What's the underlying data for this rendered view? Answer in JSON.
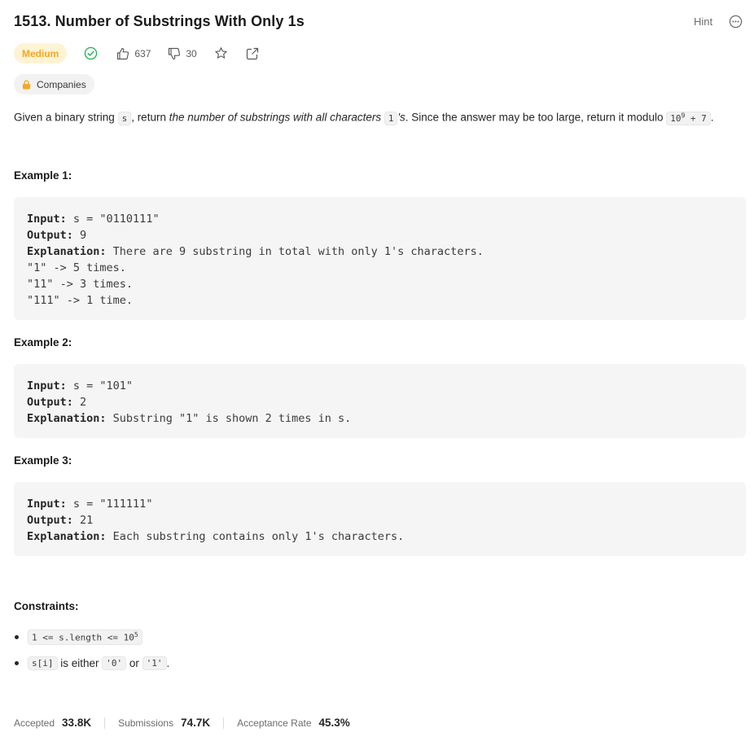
{
  "problem": {
    "title": "1513. Number of Substrings With Only 1s",
    "hint_label": "Hint",
    "difficulty": "Medium",
    "likes": "637",
    "dislikes": "30",
    "companies_label": "Companies"
  },
  "description": {
    "p1": "Given a binary string ",
    "code_s": "s",
    "p2": ", return ",
    "italic": "the number of substrings with all characters ",
    "code_1": "1",
    "p3": "'s",
    "p4": ". Since the answer may be too large, return it modulo ",
    "mod_base": "10",
    "mod_exp": "9",
    "mod_tail": " + 7",
    "p5": "."
  },
  "examples": [
    {
      "title": "Example 1:",
      "input_label": "Input:",
      "input_value": " s = \"0110111\"",
      "output_label": "Output:",
      "output_value": " 9",
      "explanation_label": "Explanation:",
      "explanation_value": " There are 9 substring in total with only 1's characters.",
      "extra": [
        "\"1\" -> 5 times.",
        "\"11\" -> 3 times.",
        "\"111\" -> 1 time."
      ]
    },
    {
      "title": "Example 2:",
      "input_label": "Input:",
      "input_value": " s = \"101\"",
      "output_label": "Output:",
      "output_value": " 2",
      "explanation_label": "Explanation:",
      "explanation_value": " Substring \"1\" is shown 2 times in s.",
      "extra": []
    },
    {
      "title": "Example 3:",
      "input_label": "Input:",
      "input_value": " s = \"111111\"",
      "output_label": "Output:",
      "output_value": " 21",
      "explanation_label": "Explanation:",
      "explanation_value": " Each substring contains only 1's characters.",
      "extra": []
    }
  ],
  "constraints": {
    "title": "Constraints:",
    "c1_code": "1 <= s.length <= 10",
    "c1_exp": "5",
    "c2_code": "s[i]",
    "c2_text1": " is either ",
    "c2_zero": "'0'",
    "c2_text2": " or ",
    "c2_one": "'1'",
    "c2_end": "."
  },
  "stats": {
    "accepted_label": "Accepted",
    "accepted_value": "33.8K",
    "submissions_label": "Submissions",
    "submissions_value": "74.7K",
    "rate_label": "Acceptance Rate",
    "rate_value": "45.3%"
  },
  "icons": {
    "solved": "check-circle-icon",
    "like": "thumbs-up-icon",
    "dislike": "thumbs-down-icon",
    "favorite": "star-icon",
    "share": "share-icon",
    "lock": "lock-icon",
    "more": "more-icon"
  },
  "colors": {
    "medium": "#f5a623",
    "medium_bg": "#fef3d4",
    "solved": "#2db55d",
    "lock": "#f5a623"
  }
}
